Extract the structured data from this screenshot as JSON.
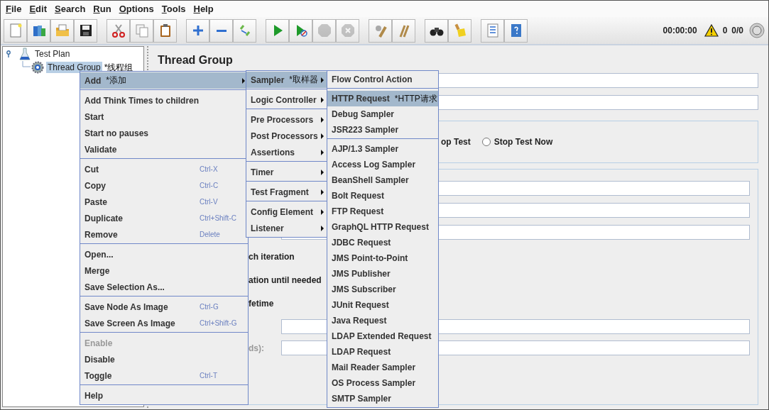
{
  "menubar": [
    "File",
    "Edit",
    "Search",
    "Run",
    "Options",
    "Tools",
    "Help"
  ],
  "toolbar": [
    [
      {
        "kind": "new",
        "disabled": false
      },
      {
        "kind": "templates",
        "disabled": false
      },
      {
        "kind": "open",
        "disabled": false
      },
      {
        "kind": "save",
        "disabled": false
      }
    ],
    [
      {
        "kind": "cut",
        "disabled": false
      },
      {
        "kind": "copy",
        "disabled": false
      },
      {
        "kind": "paste",
        "disabled": false
      }
    ],
    [
      {
        "kind": "expand",
        "disabled": false
      },
      {
        "kind": "collapse",
        "disabled": false
      },
      {
        "kind": "toggle",
        "disabled": false
      }
    ],
    [
      {
        "kind": "start",
        "disabled": false
      },
      {
        "kind": "start-no-pauses",
        "disabled": false
      },
      {
        "kind": "stop",
        "disabled": true
      },
      {
        "kind": "shutdown",
        "disabled": true
      }
    ],
    [
      {
        "kind": "clear",
        "disabled": false
      },
      {
        "kind": "clear-all",
        "disabled": false
      }
    ],
    [
      {
        "kind": "search",
        "disabled": false
      },
      {
        "kind": "reset-search",
        "disabled": false
      }
    ],
    [
      {
        "kind": "functions",
        "disabled": false
      },
      {
        "kind": "help",
        "disabled": false
      }
    ]
  ],
  "status": {
    "elapsed": "00:00:00",
    "warnings": "0",
    "threads": "0/0"
  },
  "tree": [
    {
      "label": "Test Plan",
      "expanded": true,
      "selected": false,
      "children": [
        {
          "label": "Thread Group",
          "selected": true,
          "note": "*线程组"
        }
      ]
    }
  ],
  "panel": {
    "title": "Thread Group",
    "partial_option": "op Test",
    "radios": [
      {
        "label": "Stop Test Now",
        "selected": false
      }
    ],
    "option_texts": [
      "ch iteration",
      "ation until needed",
      "fetime"
    ],
    "field_label": {
      "text": "ds):",
      "disabled": true
    }
  },
  "context_menu": [
    [
      {
        "label": "Add",
        "note": "*添加",
        "submenu": true,
        "selected": true,
        "disabled": false
      }
    ],
    [
      {
        "label": "Add Think Times to children",
        "selected": false,
        "disabled": false
      },
      {
        "label": "Start",
        "selected": false,
        "disabled": false
      },
      {
        "label": "Start no pauses",
        "selected": false,
        "disabled": false
      },
      {
        "label": "Validate",
        "selected": false,
        "disabled": false
      }
    ],
    [
      {
        "label": "Cut",
        "shortcut": "Ctrl-X",
        "selected": false,
        "disabled": false
      },
      {
        "label": "Copy",
        "shortcut": "Ctrl-C",
        "selected": false,
        "disabled": false
      },
      {
        "label": "Paste",
        "shortcut": "Ctrl-V",
        "selected": false,
        "disabled": false
      },
      {
        "label": "Duplicate",
        "shortcut": "Ctrl+Shift-C",
        "selected": false,
        "disabled": false
      },
      {
        "label": "Remove",
        "shortcut": "Delete",
        "selected": false,
        "disabled": false
      }
    ],
    [
      {
        "label": "Open...",
        "selected": false,
        "disabled": false
      },
      {
        "label": "Merge",
        "selected": false,
        "disabled": false
      },
      {
        "label": "Save Selection As...",
        "selected": false,
        "disabled": false
      }
    ],
    [
      {
        "label": "Save Node As Image",
        "shortcut": "Ctrl-G",
        "selected": false,
        "disabled": false
      },
      {
        "label": "Save Screen As Image",
        "shortcut": "Ctrl+Shift-G",
        "selected": false,
        "disabled": false
      }
    ],
    [
      {
        "label": "Enable",
        "selected": false,
        "disabled": true
      },
      {
        "label": "Disable",
        "selected": false,
        "disabled": false
      },
      {
        "label": "Toggle",
        "shortcut": "Ctrl-T",
        "selected": false,
        "disabled": false
      }
    ],
    [
      {
        "label": "Help",
        "selected": false,
        "disabled": false
      }
    ]
  ],
  "add_menu": [
    [
      {
        "label": "Sampler",
        "note": "*取样器",
        "submenu": true,
        "selected": true,
        "disabled": false
      }
    ],
    [
      {
        "label": "Logic Controller",
        "submenu": true,
        "selected": false,
        "disabled": false
      }
    ],
    [
      {
        "label": "Pre Processors",
        "submenu": true,
        "selected": false,
        "disabled": false
      },
      {
        "label": "Post Processors",
        "submenu": true,
        "selected": false,
        "disabled": false
      },
      {
        "label": "Assertions",
        "submenu": true,
        "selected": false,
        "disabled": false
      }
    ],
    [
      {
        "label": "Timer",
        "submenu": true,
        "selected": false,
        "disabled": false
      }
    ],
    [
      {
        "label": "Test Fragment",
        "submenu": true,
        "selected": false,
        "disabled": false
      }
    ],
    [
      {
        "label": "Config Element",
        "submenu": true,
        "selected": false,
        "disabled": false
      },
      {
        "label": "Listener",
        "submenu": true,
        "selected": false,
        "disabled": false
      }
    ]
  ],
  "sampler_menu": [
    [
      {
        "label": "Flow Control Action",
        "selected": false,
        "disabled": false
      }
    ],
    [
      {
        "label": "HTTP Request",
        "note": "*HTTP请求",
        "selected": true,
        "disabled": false
      },
      {
        "label": "Debug Sampler",
        "selected": false,
        "disabled": false
      },
      {
        "label": "JSR223 Sampler",
        "selected": false,
        "disabled": false
      }
    ],
    [
      {
        "label": "AJP/1.3 Sampler",
        "selected": false,
        "disabled": false
      },
      {
        "label": "Access Log Sampler",
        "selected": false,
        "disabled": false
      },
      {
        "label": "BeanShell Sampler",
        "selected": false,
        "disabled": false
      },
      {
        "label": "Bolt Request",
        "selected": false,
        "disabled": false
      },
      {
        "label": "FTP Request",
        "selected": false,
        "disabled": false
      },
      {
        "label": "GraphQL HTTP Request",
        "selected": false,
        "disabled": false
      },
      {
        "label": "JDBC Request",
        "selected": false,
        "disabled": false
      },
      {
        "label": "JMS Point-to-Point",
        "selected": false,
        "disabled": false
      },
      {
        "label": "JMS Publisher",
        "selected": false,
        "disabled": false
      },
      {
        "label": "JMS Subscriber",
        "selected": false,
        "disabled": false
      },
      {
        "label": "JUnit Request",
        "selected": false,
        "disabled": false
      },
      {
        "label": "Java Request",
        "selected": false,
        "disabled": false
      },
      {
        "label": "LDAP Extended Request",
        "selected": false,
        "disabled": false
      },
      {
        "label": "LDAP Request",
        "selected": false,
        "disabled": false
      },
      {
        "label": "Mail Reader Sampler",
        "selected": false,
        "disabled": false
      },
      {
        "label": "OS Process Sampler",
        "selected": false,
        "disabled": false
      },
      {
        "label": "SMTP Sampler",
        "selected": false,
        "disabled": false
      }
    ]
  ]
}
